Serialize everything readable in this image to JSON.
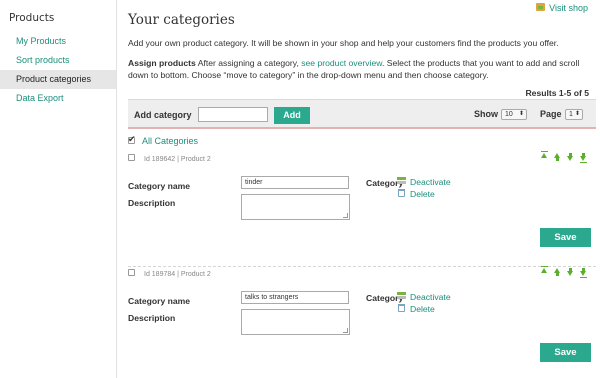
{
  "sidebar": {
    "title": "Products",
    "items": [
      {
        "label": "My Products"
      },
      {
        "label": "Sort products"
      },
      {
        "label": "Product categories"
      },
      {
        "label": "Data Export"
      }
    ]
  },
  "header": {
    "visit_shop": "Visit shop",
    "title": "Your categories",
    "intro": "Add your own product category. It will be shown in your shop and help your customers find the products you offer.",
    "assign_bold": "Assign products",
    "assign_text1": " After assigning a category, ",
    "assign_link": "see product overview",
    "assign_text2": ". Select the products that you want to add and scroll down to bottom. Choose “move to category” in the drop-down menu and then choose category.",
    "results": "Results 1-5 of 5"
  },
  "addbar": {
    "label": "Add category",
    "input_value": "",
    "button": "Add",
    "show_label": "Show",
    "show_value": "10",
    "page_label": "Page",
    "page_value": "1"
  },
  "all_categories": "All Categories",
  "categories": [
    {
      "id_text": "Id 189642 | Product 2",
      "name_label": "Category name",
      "name_value": "tinder",
      "desc_label": "Description",
      "desc_value": "",
      "category_label": "Category",
      "deactivate": "Deactivate",
      "delete": "Delete",
      "save": "Save"
    },
    {
      "id_text": "Id 189784 | Product 2",
      "name_label": "Category name",
      "name_value": "talks to strangers",
      "desc_label": "Description",
      "desc_value": "",
      "category_label": "Category",
      "deactivate": "Deactivate",
      "delete": "Delete",
      "save": "Save"
    }
  ],
  "colors": {
    "accent": "#1b8f7c",
    "button": "#2aa98f",
    "arrow": "#5aaf2d"
  }
}
